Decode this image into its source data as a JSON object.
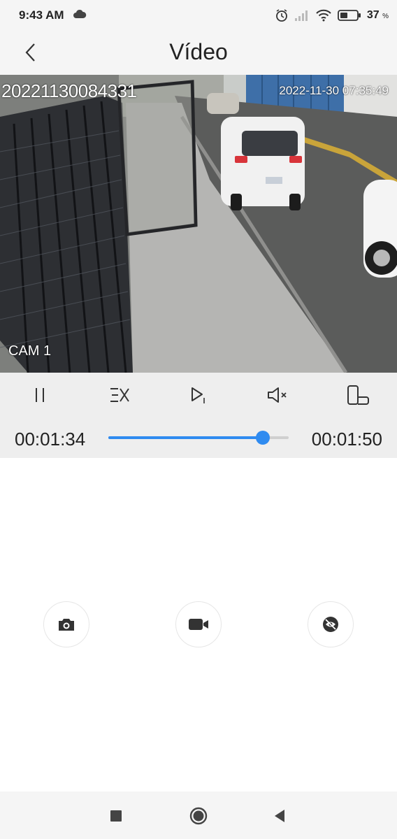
{
  "status_bar": {
    "time": "9:43 AM",
    "battery_percent": "37",
    "battery_unit": "%",
    "icons": [
      "cloud-icon",
      "alarm-icon",
      "cell-signal-icon",
      "wifi-icon",
      "battery-icon"
    ]
  },
  "header": {
    "title": "Vídeo",
    "back_icon": "chevron-left-icon"
  },
  "video": {
    "overlay_id": "20221130084331",
    "overlay_timestamp": "2022-11-30 07:35:49",
    "camera_label": "CAM 1"
  },
  "controls": {
    "buttons": [
      "pause-icon",
      "playback-speed-icon",
      "play-step-icon",
      "mute-icon",
      "rotate-screen-icon"
    ],
    "current_time": "00:01:34",
    "total_time": "00:01:50",
    "progress_fraction": 0.855,
    "accent_color": "#2f8bf0"
  },
  "actions": {
    "icons": [
      "camera-icon",
      "video-record-icon",
      "view-hide-icon"
    ]
  },
  "nav_bar": {
    "icons": [
      "recent-apps-icon",
      "home-icon",
      "back-icon"
    ]
  }
}
